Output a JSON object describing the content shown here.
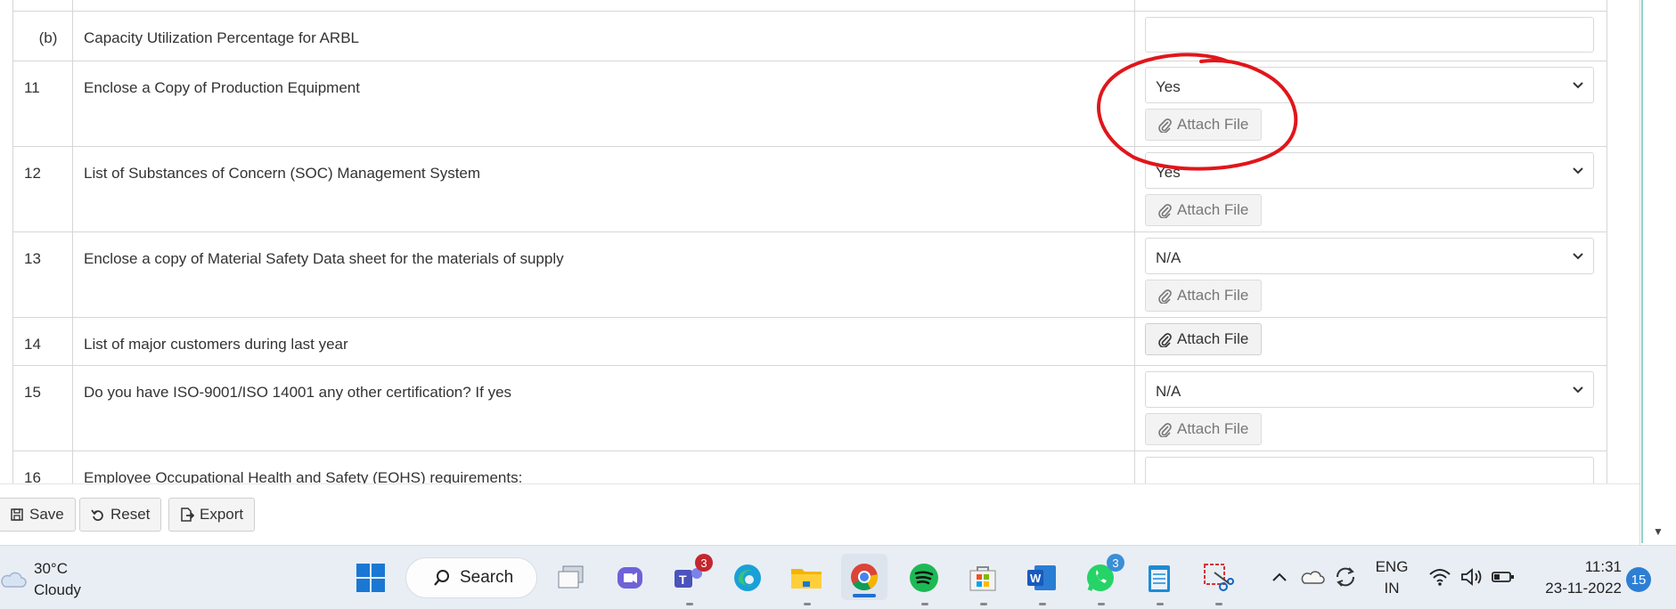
{
  "form": {
    "rows": [
      {
        "num": "(b)",
        "desc": "Capacity Utilization Percentage for ARBL",
        "control": "input"
      },
      {
        "num": "11",
        "desc": "Enclose a Copy of Production Equipment",
        "control": "select",
        "value": "Yes",
        "attach": "Attach File",
        "attach_enabled": false
      },
      {
        "num": "12",
        "desc": "List of Substances of Concern (SOC) Management System",
        "control": "select",
        "value": "Yes",
        "attach": "Attach File",
        "attach_enabled": false
      },
      {
        "num": "13",
        "desc": "Enclose a copy of Material Safety Data sheet for the materials of supply",
        "control": "select",
        "value": "N/A",
        "attach": "Attach File",
        "attach_enabled": false
      },
      {
        "num": "14",
        "desc": "List of major customers during last year",
        "control": "attach",
        "attach": "Attach File",
        "attach_enabled": true
      },
      {
        "num": "15",
        "desc": "Do you have ISO-9001/ISO 14001 any other certification? If yes",
        "control": "select",
        "value": "N/A",
        "attach": "Attach File",
        "attach_enabled": false
      },
      {
        "num": "16",
        "desc": "Employee Occupational Health and Safety (EOHS)  requirements:",
        "control": "input"
      }
    ]
  },
  "actions": {
    "save": "Save",
    "reset": "Reset",
    "export": "Export"
  },
  "taskbar": {
    "weather_temp": "30°C",
    "weather_desc": "Cloudy",
    "search_label": "Search",
    "teams_badge": "3",
    "whatsapp_badge": "3",
    "lang_1": "ENG",
    "lang_2": "IN",
    "time": "11:31",
    "date": "23-11-2022",
    "notifications": "15"
  },
  "colors": {
    "annotation": "#e0161b",
    "accent": "#1f6fd0"
  }
}
